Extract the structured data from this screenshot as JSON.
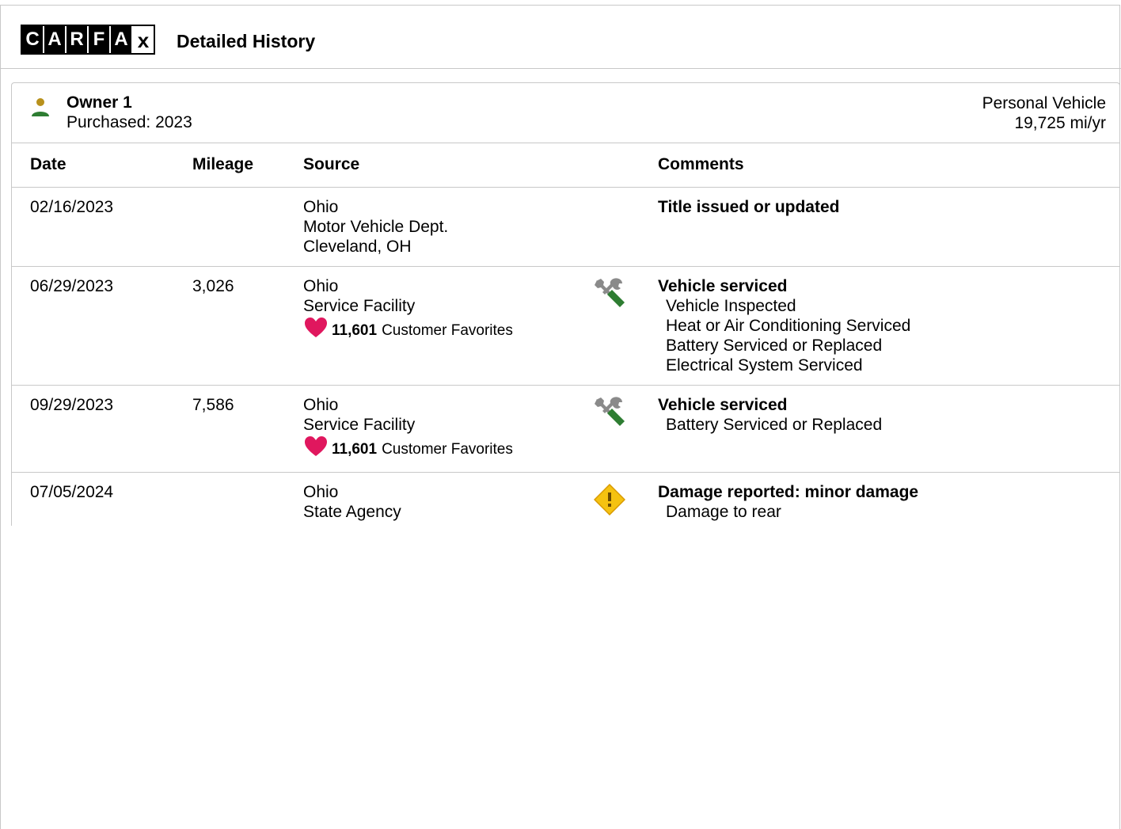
{
  "header": {
    "logo_letters": [
      "C",
      "A",
      "R",
      "F",
      "A",
      "x"
    ],
    "title": "Detailed History"
  },
  "owner": {
    "name": "Owner 1",
    "purchased": "Purchased: 2023",
    "vehicle_type": "Personal Vehicle",
    "mileage_rate": "19,725 mi/yr",
    "icon": "person-icon"
  },
  "table": {
    "columns": [
      "Date",
      "Mileage",
      "Source",
      "Comments"
    ],
    "rows": [
      {
        "date": "02/16/2023",
        "mileage": "",
        "source": [
          "Ohio",
          "Motor Vehicle Dept.",
          "Cleveland, OH"
        ],
        "favorites": null,
        "icon": "",
        "comment_title": "Title issued or updated",
        "comment_items": []
      },
      {
        "date": "06/29/2023",
        "mileage": "3,026",
        "source": [
          "Ohio",
          "Service Facility"
        ],
        "favorites": {
          "count": "11,601",
          "label": "Customer Favorites"
        },
        "icon": "wrench-screwdriver-icon",
        "comment_title": "Vehicle serviced",
        "comment_items": [
          "Vehicle Inspected",
          "Heat or Air Conditioning Serviced",
          "Battery Serviced or Replaced",
          "Electrical System Serviced"
        ]
      },
      {
        "date": "09/29/2023",
        "mileage": "7,586",
        "source": [
          "Ohio",
          "Service Facility"
        ],
        "favorites": {
          "count": "11,601",
          "label": "Customer Favorites"
        },
        "icon": "wrench-screwdriver-icon",
        "comment_title": "Vehicle serviced",
        "comment_items": [
          "Battery Serviced or Replaced"
        ]
      },
      {
        "date": "07/05/2024",
        "mileage": "",
        "source": [
          "Ohio",
          "State Agency"
        ],
        "favorites": null,
        "icon": "warning-diamond-icon",
        "comment_title": "Damage reported: minor damage",
        "comment_items": [
          "Damage to rear"
        ]
      }
    ]
  },
  "colors": {
    "border": "#c8c8c8",
    "heart": "#e0175e",
    "person_head": "#b8911c",
    "person_body": "#2e7d32",
    "tool_gray": "#8a8a8a",
    "tool_green": "#2e7d32",
    "warning_fill": "#f5c211"
  }
}
